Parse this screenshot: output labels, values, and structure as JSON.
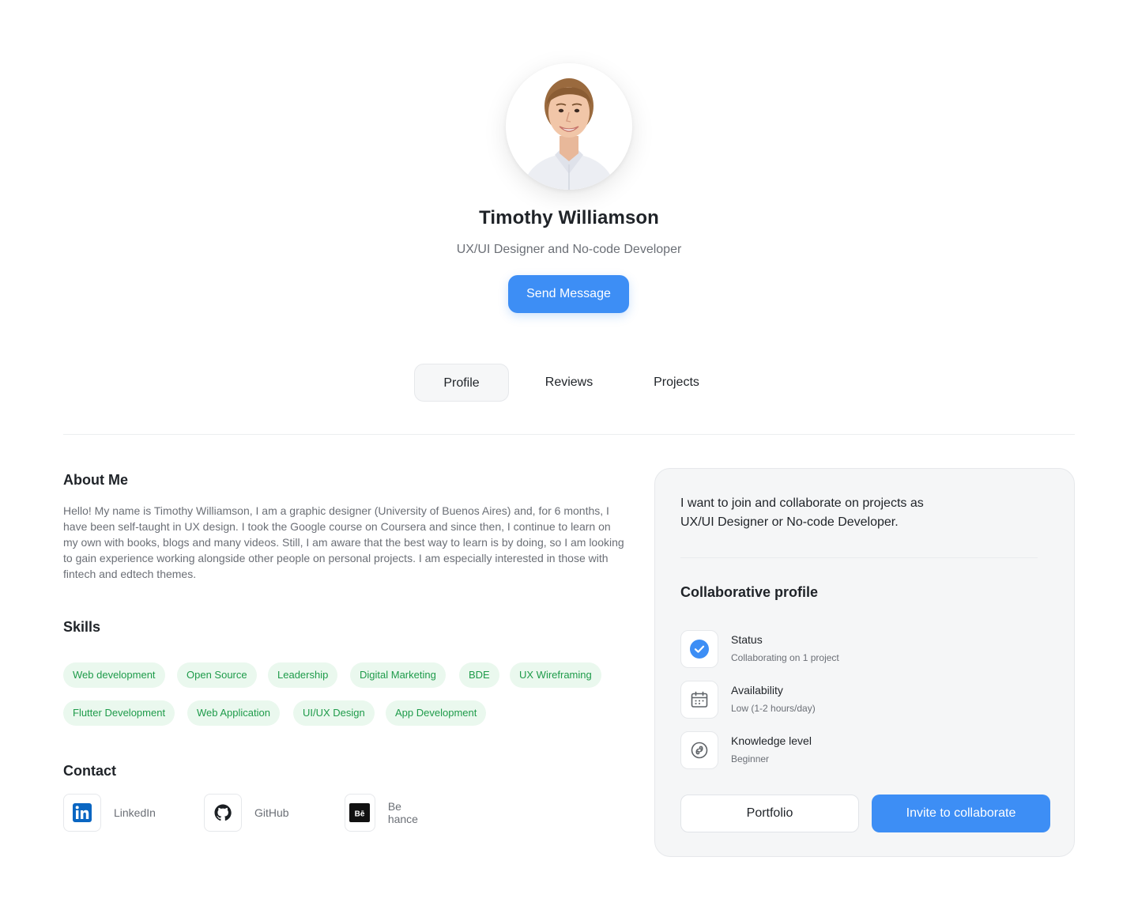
{
  "profile": {
    "name": "Timothy Williamson",
    "role": "UX/UI Designer and No-code Developer",
    "send_message_label": "Send Message"
  },
  "tabs": [
    {
      "label": "Profile",
      "active": true
    },
    {
      "label": "Reviews",
      "active": false
    },
    {
      "label": "Projects",
      "active": false
    }
  ],
  "about": {
    "title": "About Me",
    "text": "Hello! My name is Timothy Williamson, I am a graphic designer (University of Buenos Aires) and, for 6 months, I have been self-taught in UX design. I took the Google course on Coursera and since then, I continue to learn on my own with books, blogs and many videos. Still, I am aware that the best way to learn is by doing, so I am looking to gain experience working alongside other people on personal projects. I am especially interested in those with fintech and edtech themes."
  },
  "skills": {
    "title": "Skills",
    "items": [
      "Web development",
      "Open Source",
      "Leadership",
      "Digital Marketing",
      "BDE",
      "UX Wireframing",
      "Flutter Development",
      "Web Application",
      "UI/UX Design",
      "App Development"
    ]
  },
  "contact": {
    "title": "Contact",
    "items": [
      {
        "label": "LinkedIn",
        "icon": "linkedin-icon"
      },
      {
        "label": "GitHub",
        "icon": "github-icon"
      },
      {
        "label": "Be hance",
        "icon": "behance-icon"
      }
    ]
  },
  "collab_card": {
    "intro": "I want to join and collaborate on projects as UX/UI Designer or No-code Developer.",
    "title": "Collaborative profile",
    "rows": [
      {
        "label": "Status",
        "value": "Collaborating on 1 project",
        "icon": "check-circle-icon"
      },
      {
        "label": "Availability",
        "value": "Low (1-2 hours/day)",
        "icon": "calendar-icon"
      },
      {
        "label": "Knowledge level",
        "value": "Beginner",
        "icon": "knowledge-icon"
      }
    ],
    "portfolio_label": "Portfolio",
    "invite_label": "Invite to collaborate"
  },
  "colors": {
    "accent": "#3d8ef5",
    "chip_bg": "#eaf8ee",
    "chip_text": "#1e9b4a"
  }
}
